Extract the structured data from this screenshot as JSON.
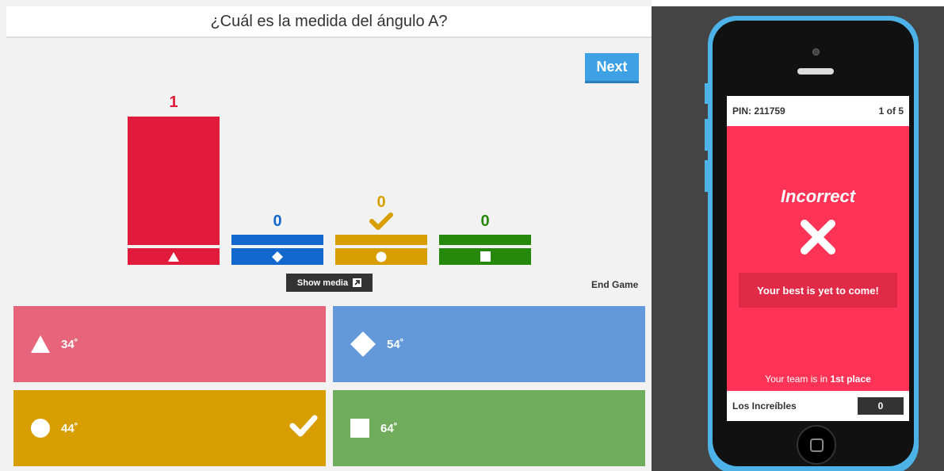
{
  "question": "¿Cuál es la medida del ángulo A?",
  "controls": {
    "next_label": "Next",
    "show_media_label": "Show media",
    "end_game_label": "End Game"
  },
  "results": [
    {
      "shape": "triangle",
      "count": "1",
      "color": "#e21b3c",
      "correct": false
    },
    {
      "shape": "diamond",
      "count": "0",
      "color": "#1368ce",
      "correct": false
    },
    {
      "shape": "circle",
      "count": "0",
      "color": "#d89e00",
      "correct": true
    },
    {
      "shape": "square",
      "count": "0",
      "color": "#26890c",
      "correct": false
    }
  ],
  "answers": [
    {
      "shape": "triangle",
      "label": "34˚",
      "color": "#e6657a",
      "correct": false
    },
    {
      "shape": "diamond",
      "label": "54˚",
      "color": "#6398da",
      "correct": false
    },
    {
      "shape": "circle",
      "label": "44˚",
      "color": "#d89e00",
      "correct": true
    },
    {
      "shape": "square",
      "label": "64˚",
      "color": "#6fad5c",
      "correct": false
    }
  ],
  "phone": {
    "pin": "PIN: 211759",
    "progress": "1 of 5",
    "result_title": "Incorrect",
    "message": "Your best is yet to come!",
    "team_rank_prefix": "Your team is in ",
    "team_rank_place": "1st place",
    "team_name": "Los Increíbles",
    "score": "0",
    "screen_color": "#fe3355"
  }
}
